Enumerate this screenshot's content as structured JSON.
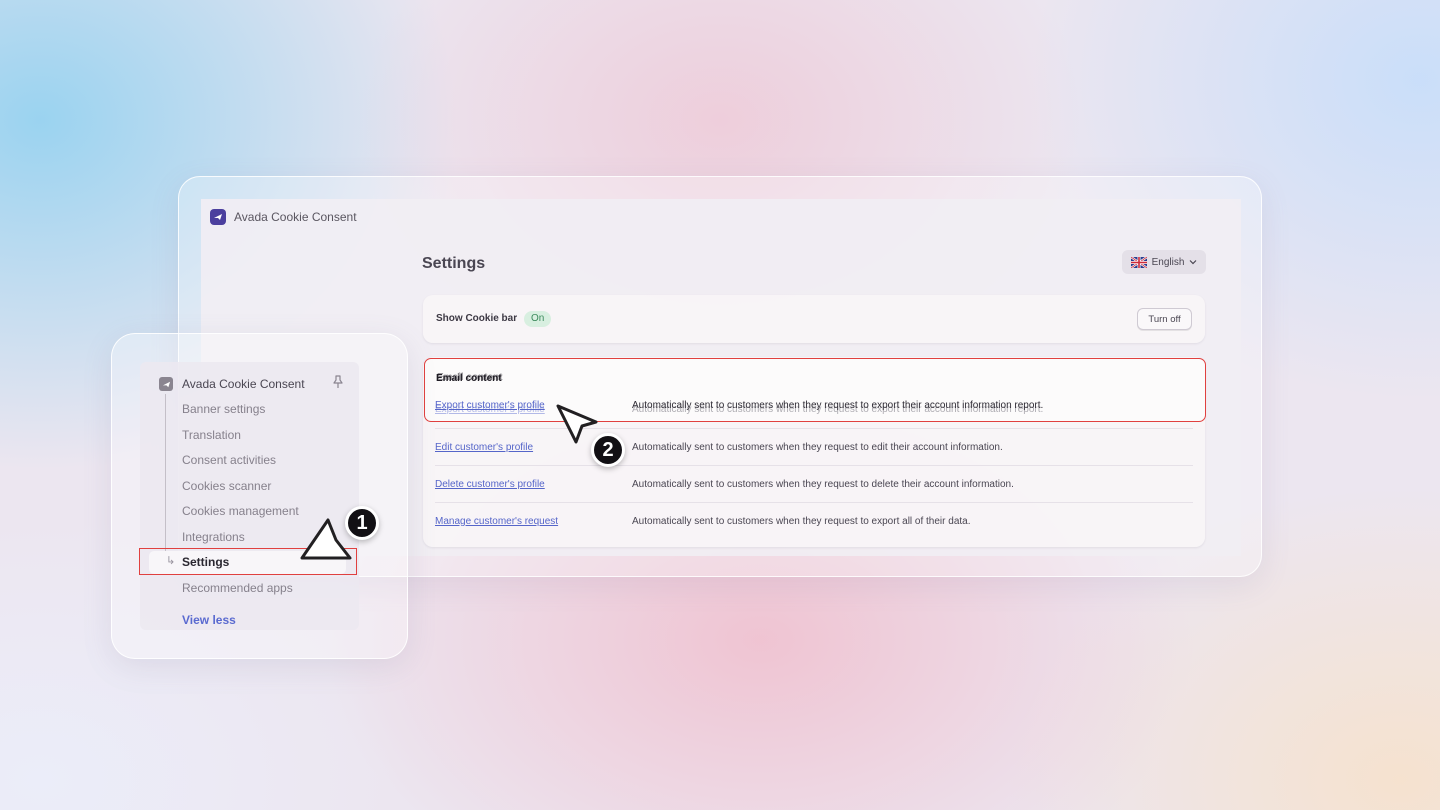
{
  "app": {
    "title": "Avada Cookie Consent"
  },
  "page": {
    "title": "Settings",
    "language": "English"
  },
  "cookie_bar": {
    "label": "Show Cookie bar",
    "status": "On",
    "toggle_label": "Turn off"
  },
  "email_content": {
    "heading": "Email content",
    "rows": [
      {
        "link": "Export customer's profile",
        "desc": "Automatically sent to customers when they request to export their account information report."
      },
      {
        "link": "Edit customer's profile",
        "desc": "Automatically sent to customers when they request to edit their account information."
      },
      {
        "link": "Delete customer's profile",
        "desc": "Automatically sent to customers when they request to delete their account information."
      },
      {
        "link": "Manage customer's request",
        "desc": "Automatically sent to customers when they request to export all of their data."
      }
    ]
  },
  "sidebar": {
    "app_name": "Avada Cookie Consent",
    "items": [
      {
        "label": "Banner settings"
      },
      {
        "label": "Translation"
      },
      {
        "label": "Consent activities"
      },
      {
        "label": "Cookies scanner"
      },
      {
        "label": "Cookies management"
      },
      {
        "label": "Integrations"
      },
      {
        "label": "Settings"
      },
      {
        "label": "Recommended apps"
      }
    ],
    "view_less": "View less"
  },
  "steps": {
    "one": "1",
    "two": "2"
  },
  "colors": {
    "highlight": "#e0403f",
    "link": "#5565c9",
    "brand": "#4b3f9e",
    "on_badge_bg": "#d8efe0",
    "on_badge_text": "#3c8a5c"
  },
  "icons": {
    "app_logo": "avada-logo-icon",
    "flag": "uk-flag-icon",
    "chevron": "chevron-down-icon",
    "pin": "pin-icon",
    "cursor": "mouse-pointer-icon"
  }
}
